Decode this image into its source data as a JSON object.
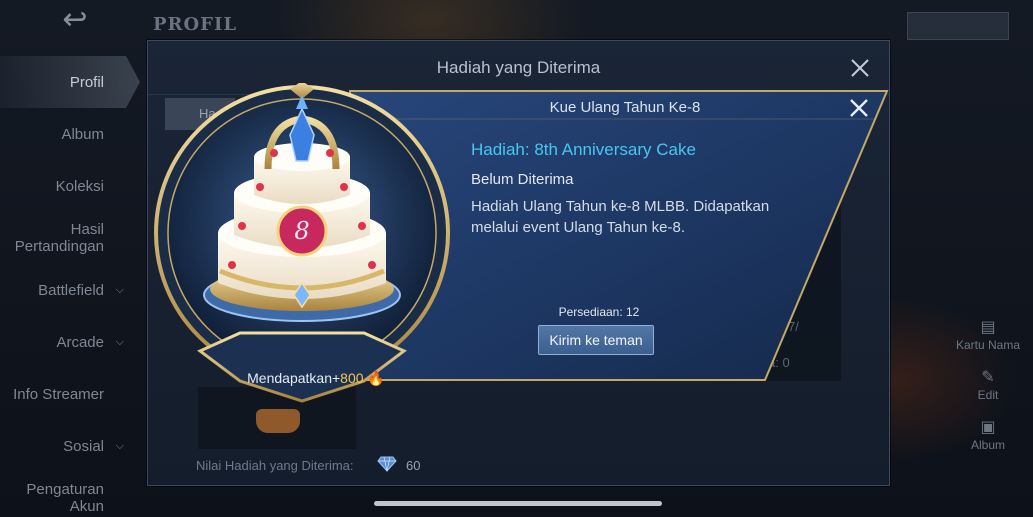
{
  "background": {
    "back_icon": "back-arrow-icon",
    "page_title": "PROFIL",
    "top_right_button": "",
    "sidebar": [
      {
        "label": "Profil",
        "active": true,
        "chevron": false
      },
      {
        "label": "Album",
        "active": false,
        "chevron": false
      },
      {
        "label": "Koleksi",
        "active": false,
        "chevron": false
      },
      {
        "label": "Hasil Pertandingan",
        "active": false,
        "chevron": false
      },
      {
        "label": "Battlefield",
        "active": false,
        "chevron": true
      },
      {
        "label": "Arcade",
        "active": false,
        "chevron": true
      },
      {
        "label": "Info Streamer",
        "active": false,
        "chevron": false
      },
      {
        "label": "Sosial",
        "active": false,
        "chevron": true
      },
      {
        "label": "Pengaturan Akun",
        "active": false,
        "chevron": false
      }
    ],
    "right_actions": [
      {
        "label": "Kartu Nama",
        "icon": "card-icon"
      },
      {
        "label": "Edit",
        "icon": "edit-icon"
      },
      {
        "label": "Album",
        "icon": "album-icon"
      }
    ]
  },
  "dialog": {
    "title": "Hadiah yang Diterima",
    "tab_label": "Ha",
    "panel_text_1": "7/",
    "panel_text_2": "a: 0",
    "total_label": "Nilai Hadiah yang Diterima:",
    "total_icon": "diamond-icon",
    "total_value": "60"
  },
  "popup": {
    "title": "Kue Ulang Tahun Ke-8",
    "reward_name": "Hadiah: 8th Anniversary Cake",
    "status": "Belum Diterima",
    "description": "Hadiah Ulang Tahun ke-8 MLBB. Didapatkan melalui event Ulang Tahun ke-8.",
    "stock_label": "Persediaan: 12",
    "send_button": "Kirim ke teman",
    "earn_prefix": "Mendapatkan+",
    "earn_value": "800",
    "earn_icon": "flame-icon",
    "item_icon": "anniversary-cake-icon"
  },
  "colors": {
    "accent_cyan": "#46c7f0",
    "gold": "#d4b06a",
    "earn_value": "#f3c64f",
    "button": "#4a6d9c"
  }
}
